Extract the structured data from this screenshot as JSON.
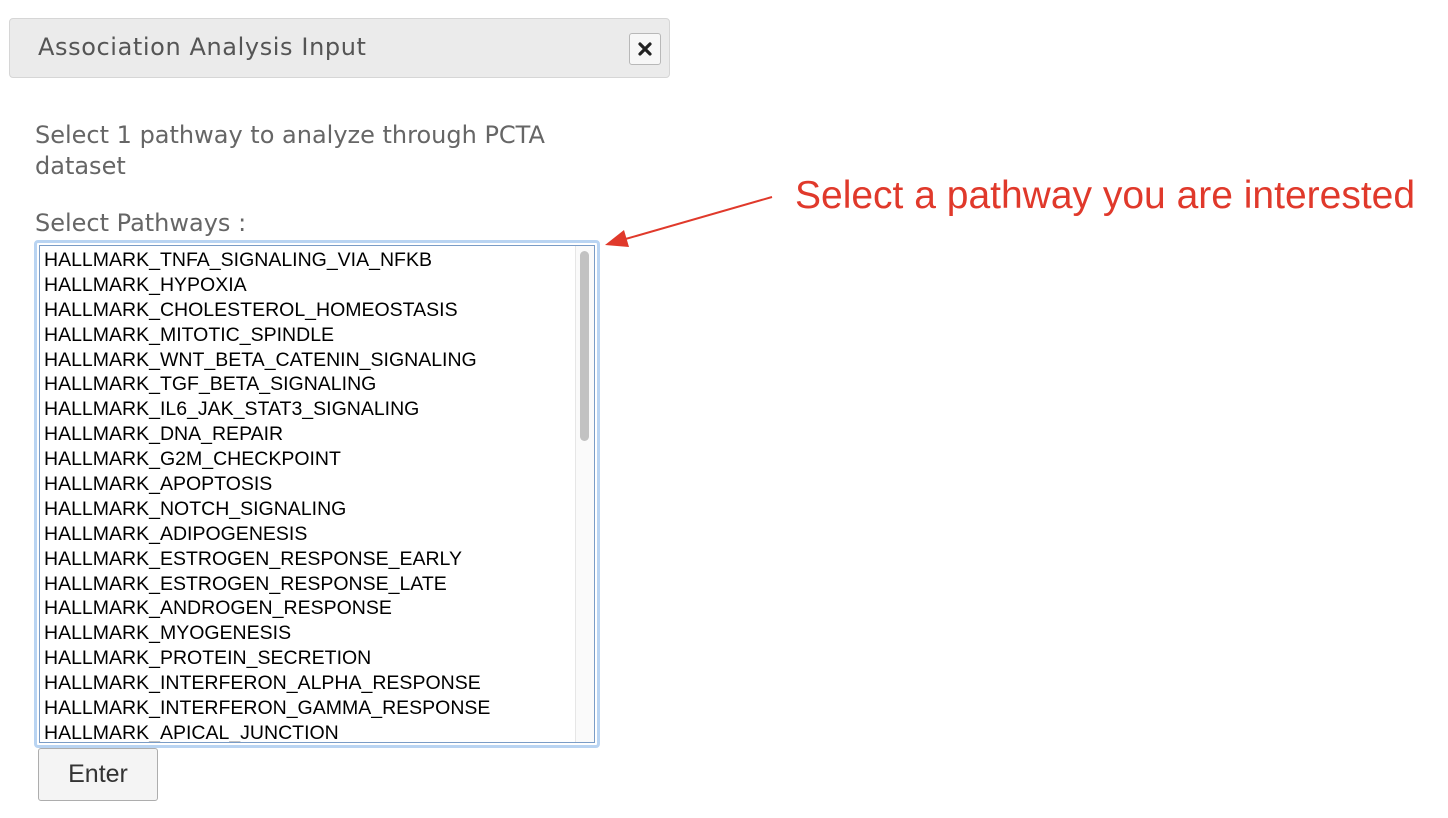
{
  "dialog": {
    "title": "Association Analysis Input",
    "close_icon": "close-x-icon"
  },
  "form": {
    "instructions": "Select 1 pathway to analyze through PCTA dataset",
    "select_label": "Select Pathways :",
    "pathways": [
      "HALLMARK_TNFA_SIGNALING_VIA_NFKB",
      "HALLMARK_HYPOXIA",
      "HALLMARK_CHOLESTEROL_HOMEOSTASIS",
      "HALLMARK_MITOTIC_SPINDLE",
      "HALLMARK_WNT_BETA_CATENIN_SIGNALING",
      "HALLMARK_TGF_BETA_SIGNALING",
      "HALLMARK_IL6_JAK_STAT3_SIGNALING",
      "HALLMARK_DNA_REPAIR",
      "HALLMARK_G2M_CHECKPOINT",
      "HALLMARK_APOPTOSIS",
      "HALLMARK_NOTCH_SIGNALING",
      "HALLMARK_ADIPOGENESIS",
      "HALLMARK_ESTROGEN_RESPONSE_EARLY",
      "HALLMARK_ESTROGEN_RESPONSE_LATE",
      "HALLMARK_ANDROGEN_RESPONSE",
      "HALLMARK_MYOGENESIS",
      "HALLMARK_PROTEIN_SECRETION",
      "HALLMARK_INTERFERON_ALPHA_RESPONSE",
      "HALLMARK_INTERFERON_GAMMA_RESPONSE",
      "HALLMARK_APICAL_JUNCTION"
    ],
    "enter_label": "Enter"
  },
  "annotation": {
    "text": "Select a pathway you are interested",
    "color": "#e0392b"
  },
  "colors": {
    "header_bg": "#ebebeb",
    "focus_ring": "#b9d4f2",
    "label_text": "#666666"
  }
}
